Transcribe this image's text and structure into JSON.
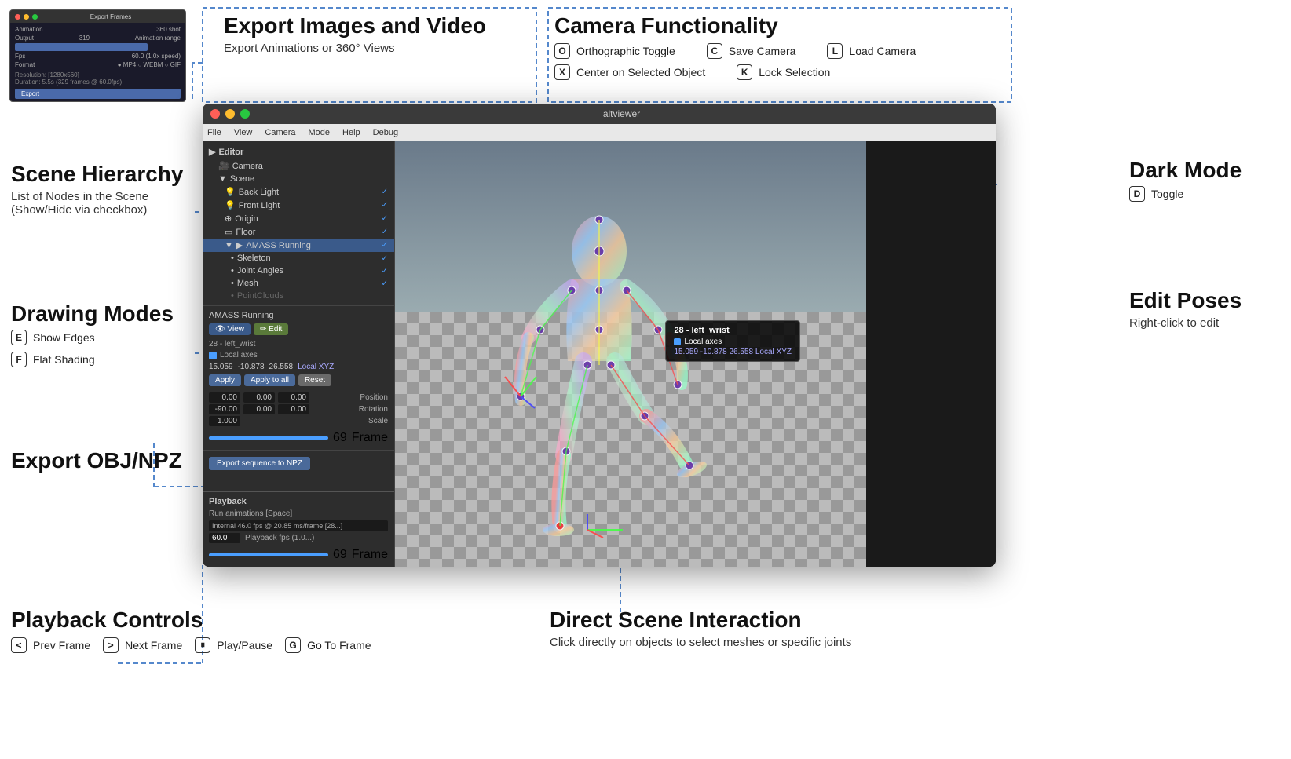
{
  "app": {
    "title": "altviewer",
    "window_controls": [
      "close",
      "minimize",
      "maximize"
    ],
    "menu_items": [
      "File",
      "View",
      "Camera",
      "Mode",
      "Help",
      "Debug"
    ]
  },
  "sections": {
    "export_images": {
      "title": "Export Images and Video",
      "subtitle": "Export Animations or 360° Views"
    },
    "camera_functionality": {
      "title": "Camera Functionality",
      "items": [
        {
          "key": "O",
          "label": "Orthographic Toggle"
        },
        {
          "key": "X",
          "label": "Center on Selected Object"
        },
        {
          "key": "C",
          "label": "Save Camera"
        },
        {
          "key": "K",
          "label": "Lock Selection"
        },
        {
          "key": "L",
          "label": "Load Camera"
        }
      ]
    },
    "scene_hierarchy": {
      "title": "Scene Hierarchy",
      "subtitle": "List of Nodes in the Scene",
      "detail": "(Show/Hide via checkbox)"
    },
    "dark_mode": {
      "title": "Dark Mode",
      "key": "D",
      "label": "Toggle"
    },
    "drawing_modes": {
      "title": "Drawing Modes",
      "items": [
        {
          "key": "E",
          "label": "Show Edges"
        },
        {
          "key": "F",
          "label": "Flat Shading"
        }
      ]
    },
    "edit_poses": {
      "title": "Edit Poses",
      "subtitle": "Right-click to edit"
    },
    "export_obj": {
      "title": "Export OBJ/NPZ"
    },
    "playback_controls": {
      "title": "Playback Controls",
      "items": [
        {
          "key": "<",
          "label": "Prev Frame"
        },
        {
          "key": ">",
          "label": "Next Frame"
        },
        {
          "key": "—",
          "label": "Play/Pause"
        },
        {
          "key": "G",
          "label": "Go To Frame"
        }
      ]
    },
    "direct_scene": {
      "title": "Direct Scene Interaction",
      "subtitle": "Click directly on objects to select meshes or specific joints"
    }
  },
  "editor_panel": {
    "header": "Editor",
    "camera_label": "Camera",
    "scene_label": "Scene",
    "tree_items": [
      {
        "label": "Back Light",
        "checked": true,
        "indent": 1
      },
      {
        "label": "Front Light",
        "checked": true,
        "indent": 1
      },
      {
        "label": "Origin",
        "checked": true,
        "indent": 1
      },
      {
        "label": "Floor",
        "checked": true,
        "indent": 1
      },
      {
        "label": "AMASS Running",
        "checked": true,
        "indent": 1,
        "selected": true
      },
      {
        "label": "Skeleton",
        "checked": true,
        "indent": 2
      },
      {
        "label": "Joint Angles",
        "checked": true,
        "indent": 2
      },
      {
        "label": "Mesh",
        "checked": true,
        "indent": 2
      },
      {
        "label": "PointClouds",
        "checked": false,
        "indent": 2,
        "disabled": true
      }
    ],
    "node_section": {
      "title": "AMASS Running",
      "tab_view": "View",
      "tab_edit": "Edit",
      "node_name": "28 - left_wrist",
      "local_axes_checked": true,
      "local_axes_label": "Local axes",
      "coords": [
        "15.059",
        "-10.878",
        "26.558"
      ],
      "coords_label": "Local XYZ",
      "buttons": [
        "Apply",
        "Apply to all",
        "Reset"
      ],
      "transforms": [
        {
          "values": [
            "0.00",
            "0.00",
            "0.00"
          ],
          "label": "Position"
        },
        {
          "values": [
            "-90.00",
            "0.00",
            "0.00"
          ],
          "label": "Rotation"
        },
        {
          "values": [
            "1.000"
          ],
          "label": "Scale"
        }
      ],
      "frame_value": "69",
      "frame_label": "Frame"
    },
    "export_btn": "Export sequence to NPZ"
  },
  "playback_panel": {
    "header": "Playback",
    "run_label": "Run animations [Space]",
    "fps_internal": "Internal 46.0 fps @ 20.85 ms/frame [28...]",
    "fps_value": "60.0",
    "fps_label": "Playback fps (1.0...)",
    "frame_value": "69",
    "frame_label": "Frame"
  },
  "viewport_tooltip": {
    "title": "28 - left_wrist",
    "local_axes_label": "Local axes",
    "coords": "15.059  -10.878  26.558  Local XYZ"
  }
}
